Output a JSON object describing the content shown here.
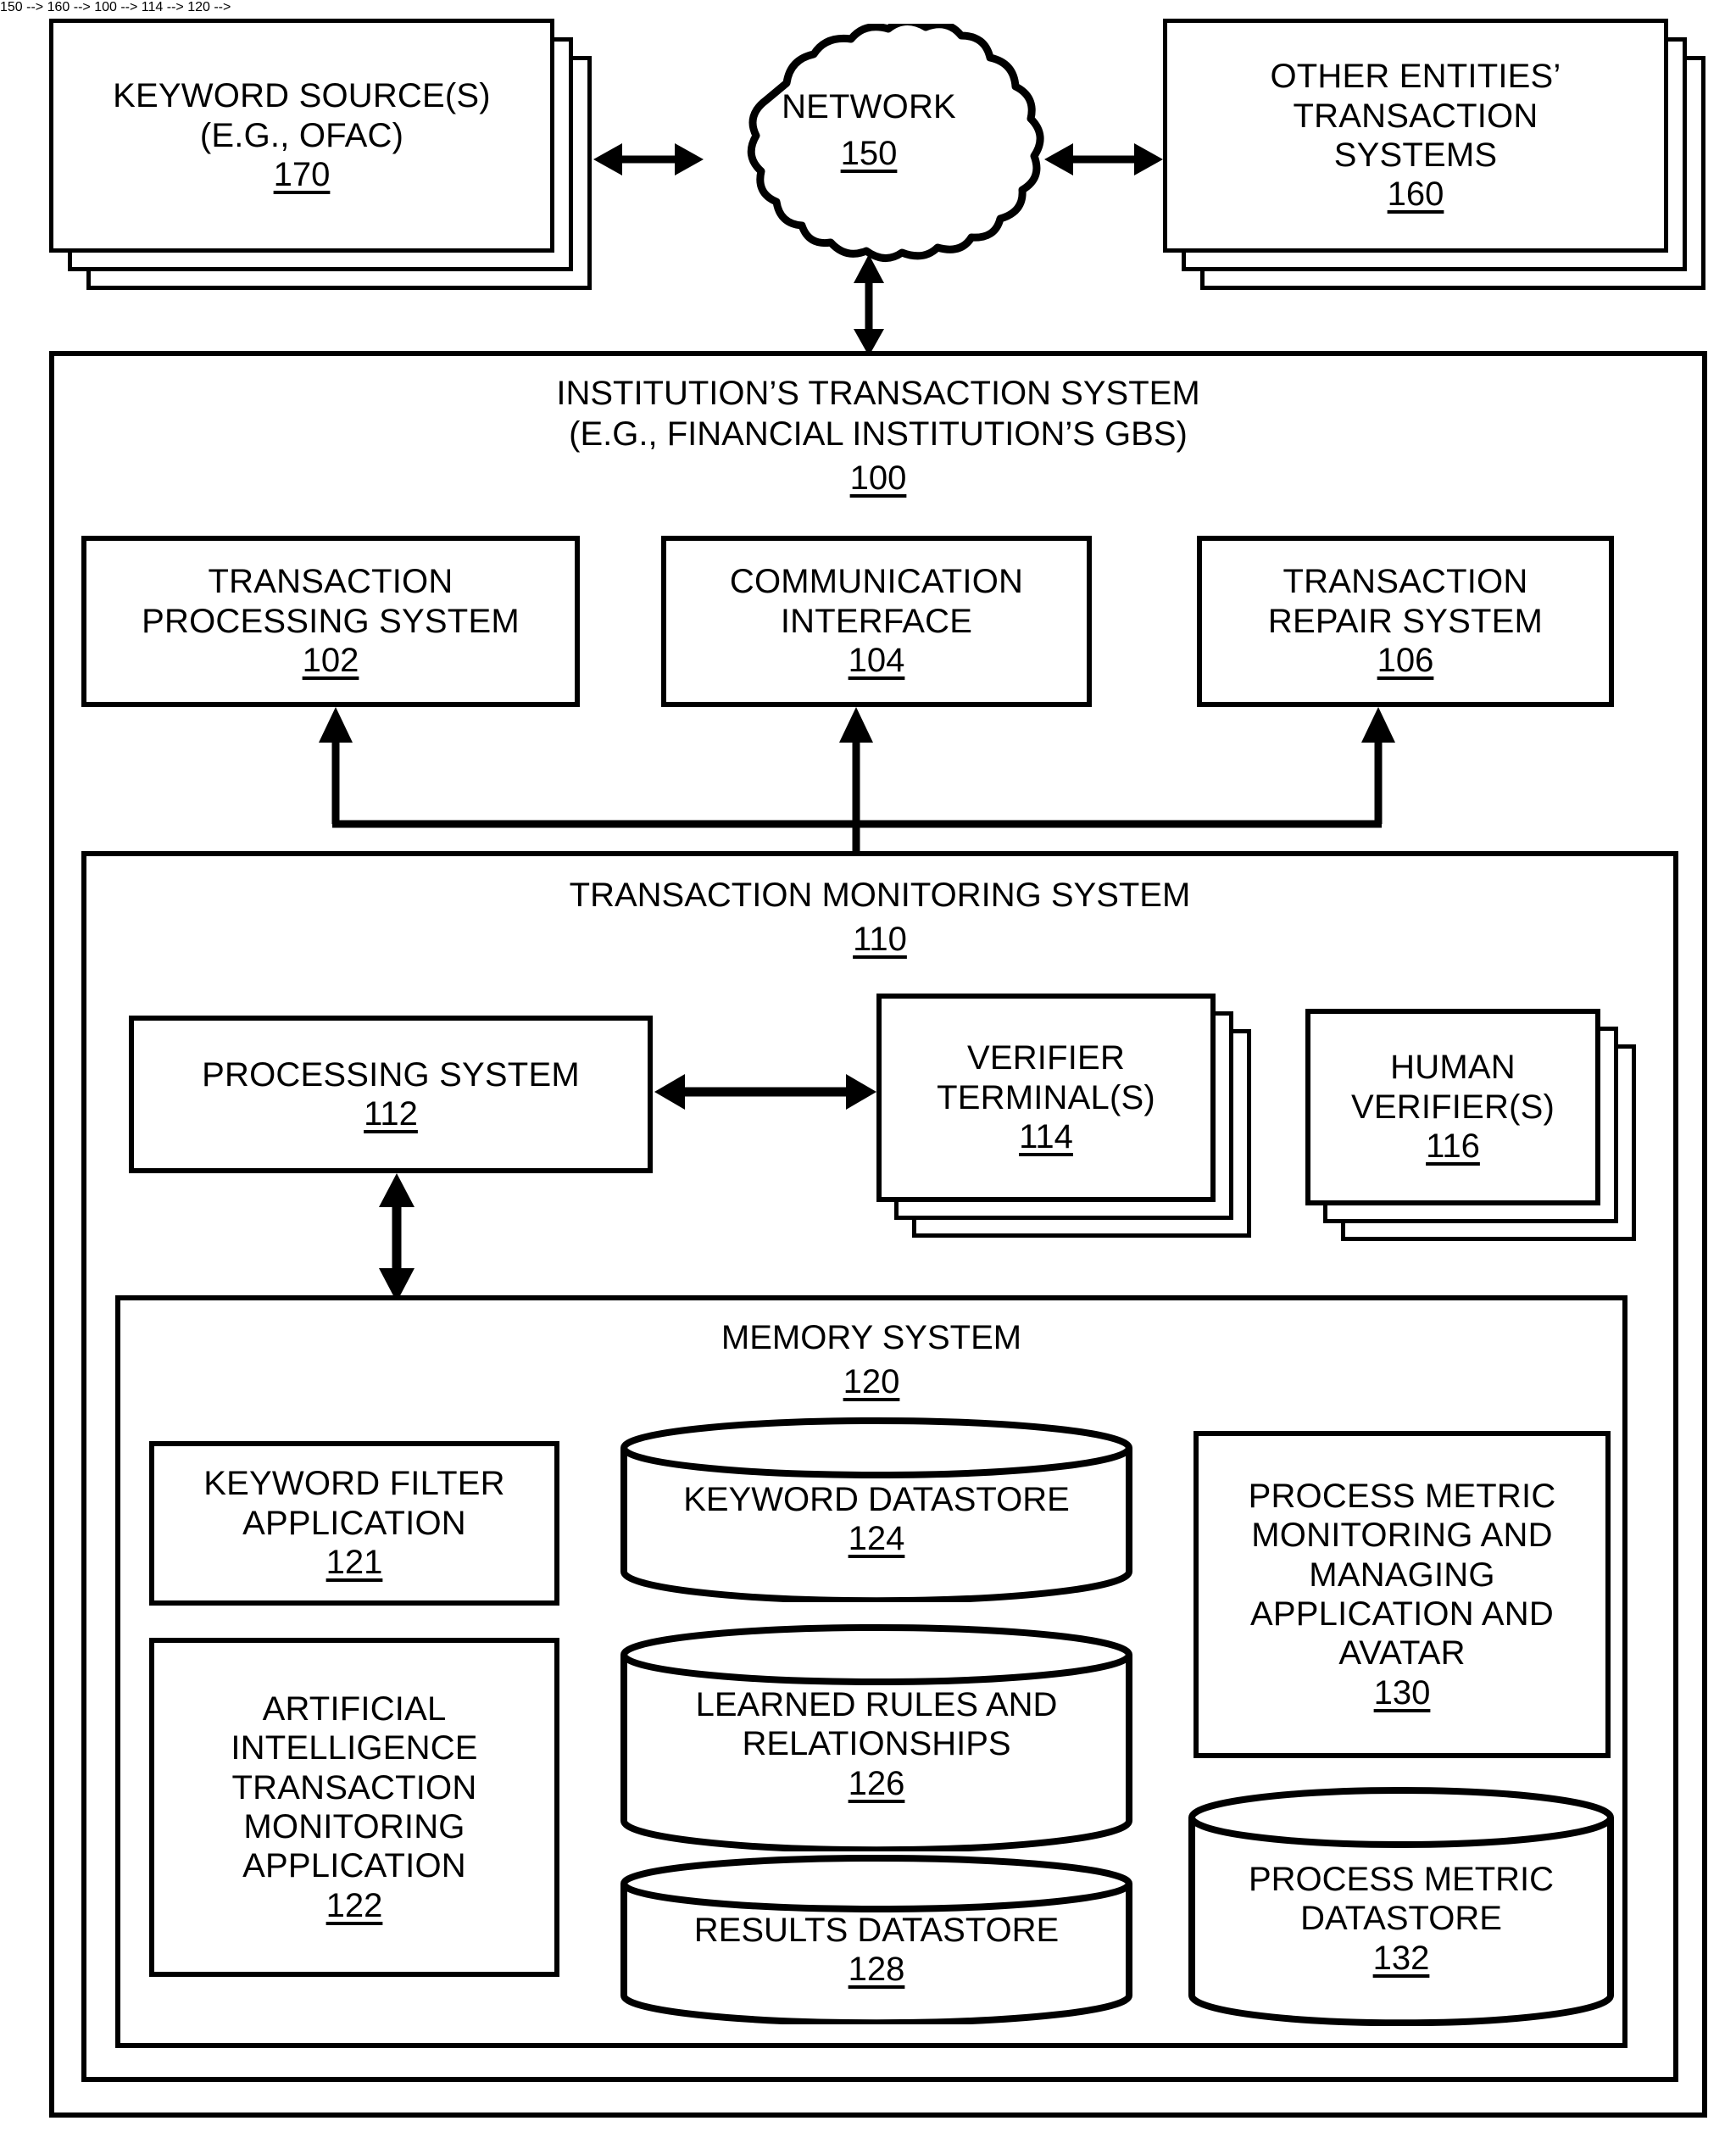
{
  "figure": {
    "type": "block-diagram",
    "style": "patent-line-drawing",
    "stroke_color": "#000000",
    "background_color": "#ffffff"
  },
  "nodes": {
    "keyword_sources": {
      "lines": [
        "KEYWORD SOURCE(S)",
        "(E.G., OFAC)"
      ],
      "line1": "KEYWORD SOURCE(S)",
      "line2": "(E.G., OFAC)",
      "ref": "170",
      "shape": "stacked-box"
    },
    "network": {
      "label": "NETWORK",
      "ref": "150",
      "shape": "cloud"
    },
    "other_entities": {
      "line1": "OTHER ENTITIES’",
      "line2": "TRANSACTION",
      "line3": "SYSTEMS",
      "ref": "160",
      "shape": "stacked-box"
    },
    "institution_system": {
      "line1": "INSTITUTION’S TRANSACTION SYSTEM",
      "line2": "(E.G., FINANCIAL INSTITUTION’S GBS)",
      "ref": "100",
      "shape": "frame"
    },
    "transaction_processing": {
      "line1": "TRANSACTION",
      "line2": "PROCESSING SYSTEM",
      "ref": "102",
      "shape": "box"
    },
    "communication_interface": {
      "line1": "COMMUNICATION",
      "line2": "INTERFACE",
      "ref": "104",
      "shape": "box"
    },
    "transaction_repair": {
      "line1": "TRANSACTION",
      "line2": "REPAIR SYSTEM",
      "ref": "106",
      "shape": "box"
    },
    "transaction_monitoring": {
      "label": "TRANSACTION MONITORING SYSTEM",
      "ref": "110",
      "shape": "frame"
    },
    "processing_system": {
      "label": "PROCESSING SYSTEM",
      "ref": "112",
      "shape": "box"
    },
    "verifier_terminals": {
      "line1": "VERIFIER",
      "line2": "TERMINAL(S)",
      "ref": "114",
      "shape": "stacked-box"
    },
    "human_verifiers": {
      "line1": "HUMAN",
      "line2": "VERIFIER(S)",
      "ref": "116",
      "shape": "stacked-box"
    },
    "memory_system": {
      "label": "MEMORY SYSTEM",
      "ref": "120",
      "shape": "frame"
    },
    "keyword_filter_application": {
      "line1": "KEYWORD FILTER",
      "line2": "APPLICATION",
      "ref": "121",
      "shape": "box"
    },
    "ai_transaction_monitoring_application": {
      "line1": "ARTIFICIAL",
      "line2": "INTELLIGENCE",
      "line3": "TRANSACTION",
      "line4": "MONITORING",
      "line5": "APPLICATION",
      "ref": "122",
      "shape": "box"
    },
    "keyword_datastore": {
      "label": "KEYWORD DATASTORE",
      "ref": "124",
      "shape": "cylinder"
    },
    "learned_rules_datastore": {
      "line1": "LEARNED RULES AND",
      "line2": "RELATIONSHIPS",
      "ref": "126",
      "shape": "cylinder"
    },
    "results_datastore": {
      "label": "RESULTS DATASTORE",
      "ref": "128",
      "shape": "cylinder"
    },
    "process_metric_application": {
      "line1": "PROCESS METRIC",
      "line2": "MONITORING AND",
      "line3": "MANAGING",
      "line4": "APPLICATION AND",
      "line5": "AVATAR",
      "ref": "130",
      "shape": "box"
    },
    "process_metric_datastore": {
      "line1": "PROCESS METRIC",
      "line2": "DATASTORE",
      "ref": "132",
      "shape": "cylinder"
    }
  },
  "connections": [
    {
      "id": "keyword-sources-to-network",
      "from": "170",
      "to": "150",
      "kind": "double-arrow",
      "orientation": "horizontal"
    },
    {
      "id": "network-to-other-entities",
      "from": "150",
      "to": "160",
      "kind": "double-arrow",
      "orientation": "horizontal"
    },
    {
      "id": "network-to-institution-system",
      "from": "150",
      "to": "100",
      "kind": "double-arrow",
      "orientation": "vertical"
    },
    {
      "id": "bus-to-transaction-processing",
      "from": "110",
      "to": "102",
      "kind": "single-arrow",
      "orientation": "vertical"
    },
    {
      "id": "bus-to-communication-interface",
      "from": "110",
      "to": "104",
      "kind": "single-arrow",
      "orientation": "vertical"
    },
    {
      "id": "bus-to-transaction-repair",
      "from": "110",
      "to": "106",
      "kind": "single-arrow",
      "orientation": "vertical"
    },
    {
      "id": "institution-bus-to-monitoring",
      "from": "100",
      "to": "110",
      "kind": "single-arrow",
      "orientation": "vertical"
    },
    {
      "id": "processing-system-to-verifier-terminals",
      "from": "112",
      "to": "114",
      "kind": "double-arrow",
      "orientation": "horizontal"
    },
    {
      "id": "processing-system-to-memory-system",
      "from": "112",
      "to": "120",
      "kind": "double-arrow",
      "orientation": "vertical"
    }
  ]
}
